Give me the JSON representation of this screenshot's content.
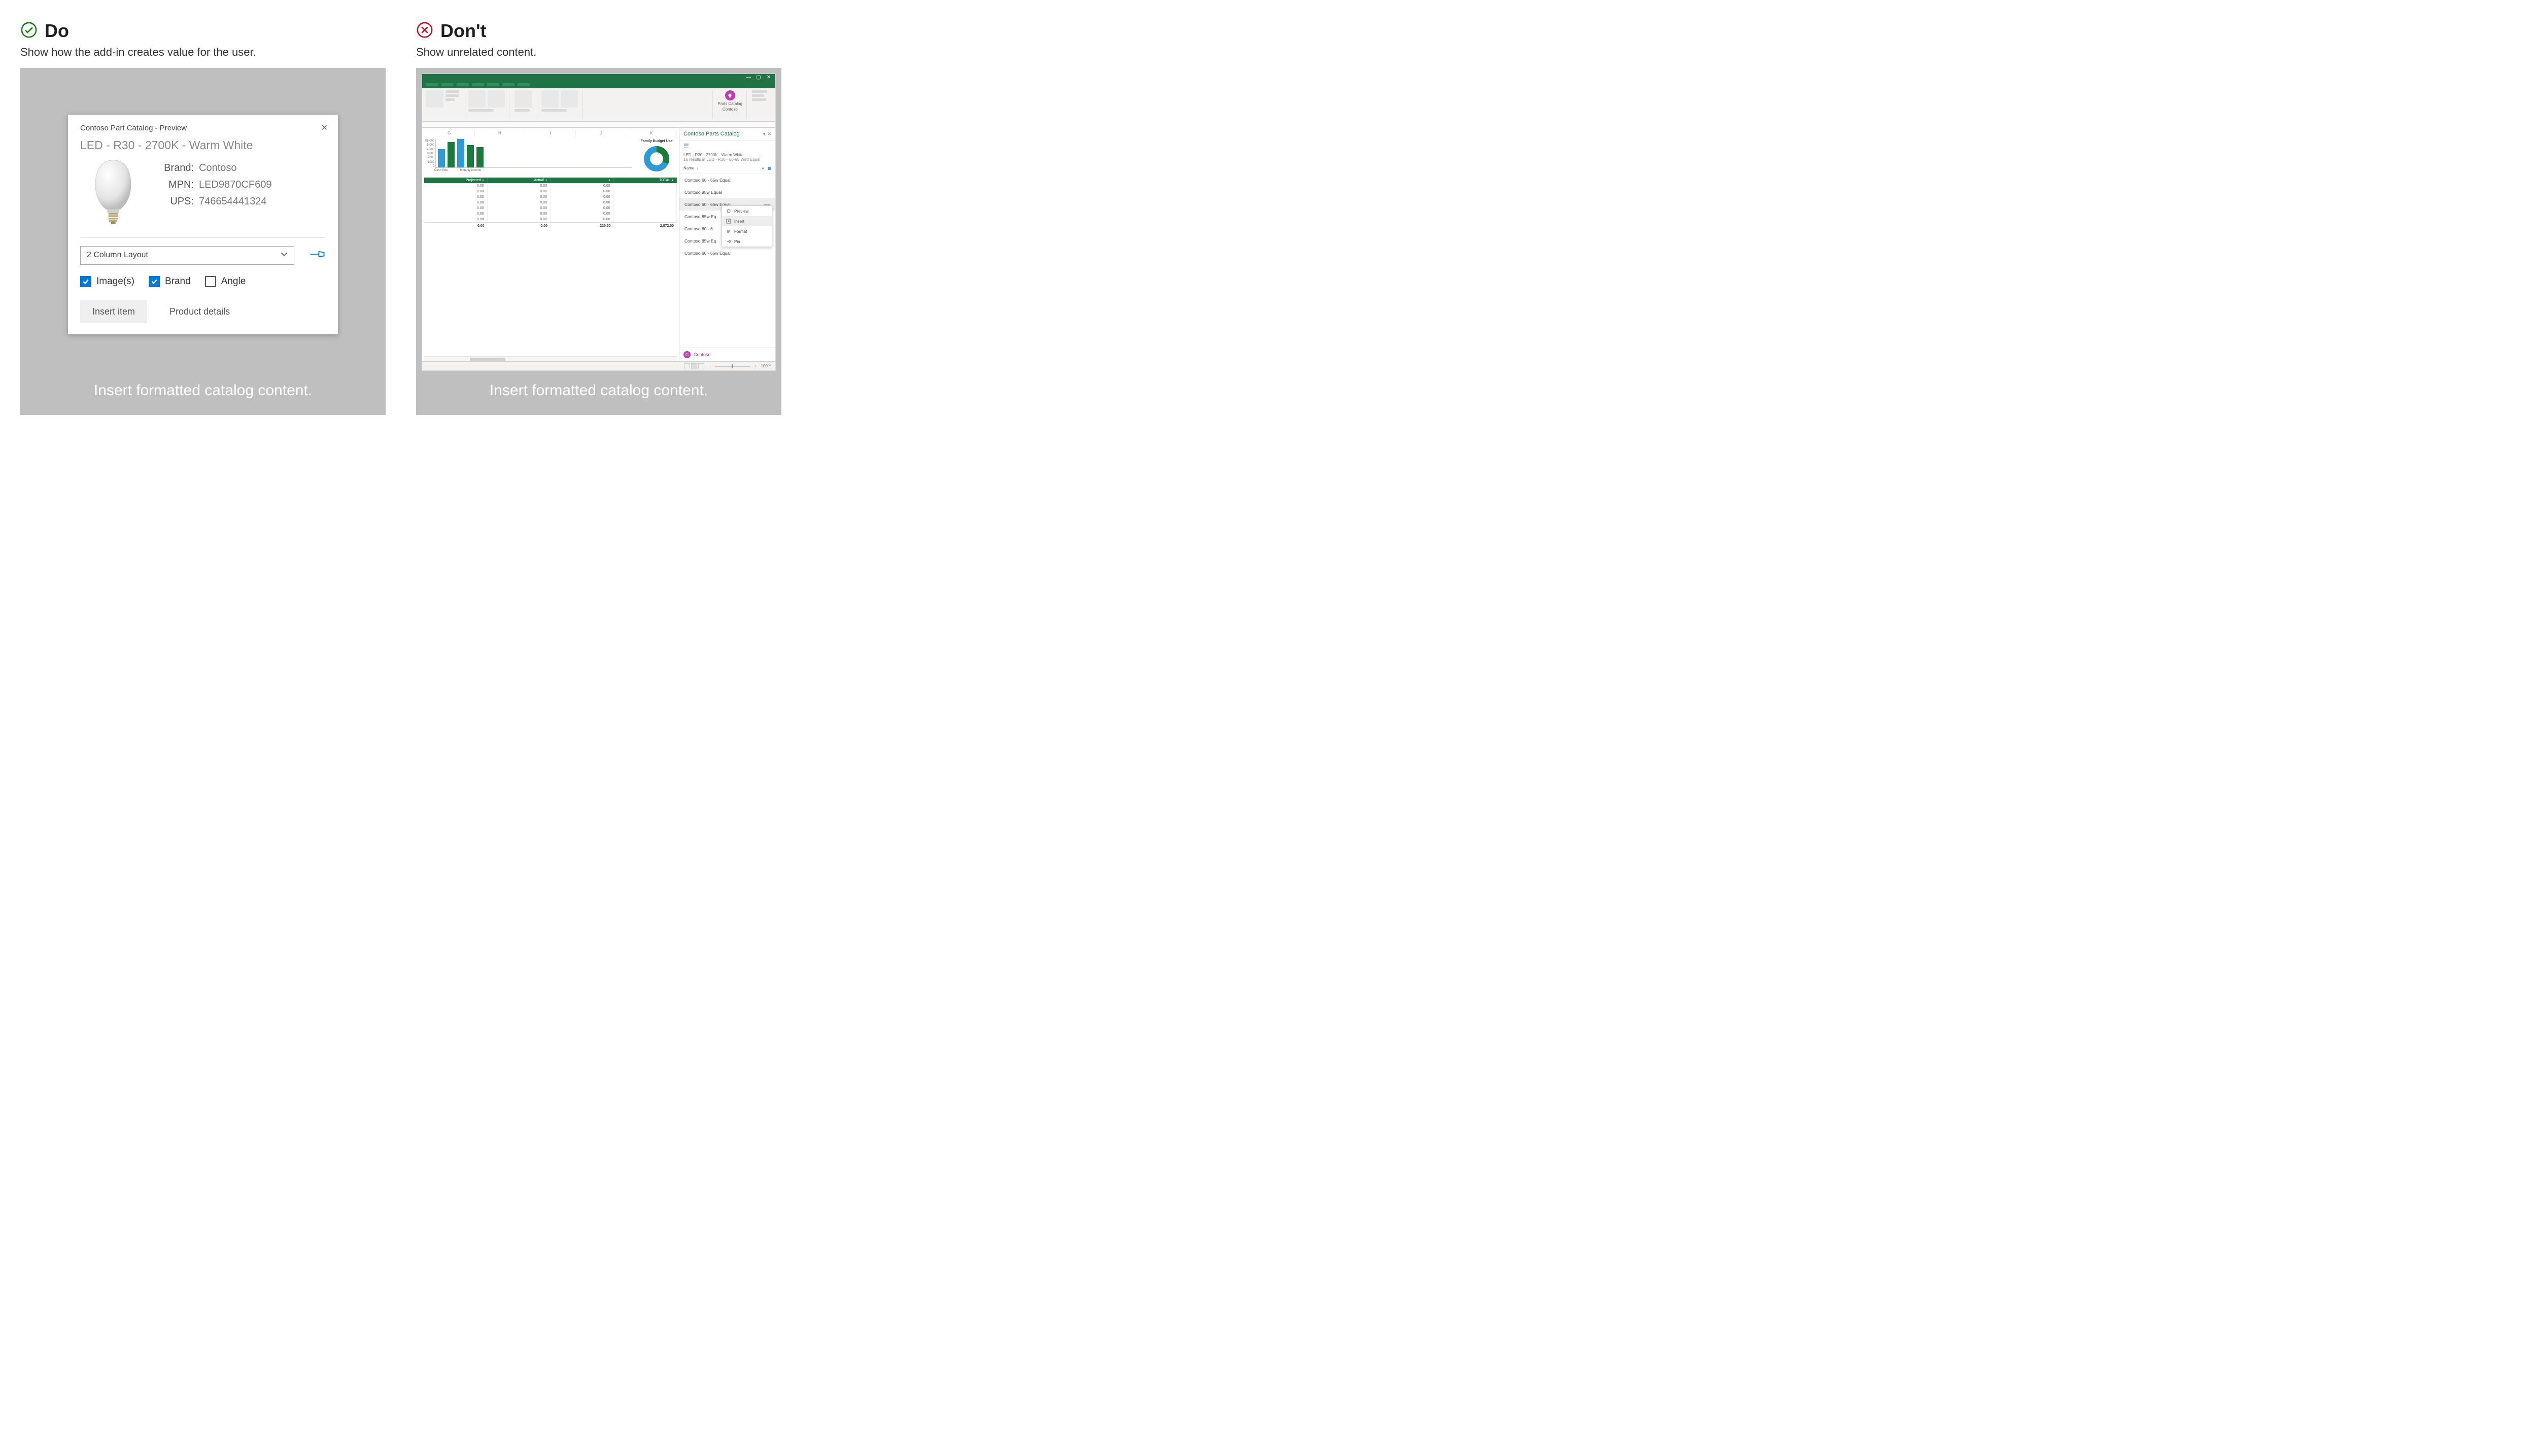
{
  "do": {
    "title": "Do",
    "subtitle": "Show how the add-in creates value for the user.",
    "caption": "Insert formatted catalog content.",
    "dialog": {
      "title": "Contoso Part Catalog - Preview",
      "product_name": "LED - R30 - 2700K - Warm White",
      "brand_k": "Brand:",
      "brand_v": "Contoso",
      "mpn_k": "MPN:",
      "mpn_v": "LED9870CF609",
      "ups_k": "UPS:",
      "ups_v": "746654441324",
      "layout_select": "2 Column Layout",
      "chk_images": "Image(s)",
      "chk_brand": "Brand",
      "chk_angle": "Angle",
      "btn_insert": "Insert item",
      "btn_details": "Product details"
    }
  },
  "dont": {
    "title": "Don't",
    "subtitle": "Show unrelated content.",
    "caption": "Insert formatted catalog content.",
    "excel": {
      "addin_label1": "Parts Catalog",
      "addin_label2": "Contoso",
      "columns": [
        "G",
        "H",
        "I",
        "J",
        "K"
      ],
      "yaxis": [
        "$6,000",
        "5,000",
        "4,000",
        "3,000",
        "2000",
        "1000",
        "0"
      ],
      "bar_series": [
        {
          "h": 36,
          "cls": "b1"
        },
        {
          "h": 50,
          "cls": "b2"
        },
        {
          "h": 56,
          "cls": "b1"
        },
        {
          "h": 44,
          "cls": "b2"
        },
        {
          "h": 40,
          "cls": "b2"
        }
      ],
      "xlabels": [
        "Cash flow",
        "Monthly income"
      ],
      "donut_title": "Family Budget Use",
      "table_headers": [
        "Projected",
        "Actual",
        "",
        "TOTAL"
      ],
      "table_rows": [
        [
          "0.00",
          "0.00",
          "0.00",
          ""
        ],
        [
          "0.00",
          "0.00",
          "0.00",
          ""
        ],
        [
          "0.00",
          "0.00",
          "0.00",
          ""
        ],
        [
          "0.00",
          "0.00",
          "0.00",
          ""
        ],
        [
          "0.00",
          "0.00",
          "0.00",
          ""
        ],
        [
          "0.00",
          "0.00",
          "0.00",
          ""
        ],
        [
          "0.00",
          "0.00",
          "0.00",
          ""
        ]
      ],
      "table_footer": [
        "0.00",
        "0.00",
        "225.50",
        "2,872.00"
      ],
      "taskpane": {
        "title": "Contoso Parts Catalog",
        "breadcrumb": "LED - R30 - 2700K - Warm White",
        "bc_sub": "16 results in LED - R30 - 60-65 Watt Equal",
        "sort_label": "Name",
        "items": [
          "Contoso 60 - 65w Equal",
          "Contoso 85w Equal",
          "Contoso 60 - 65w Equal",
          "Contoso 85w Eq",
          "Contoso 60 - 6",
          "Contoso 85w Eq",
          "Contoso 60 - 65w Equal"
        ],
        "menu": [
          "Preview",
          "Insert",
          "Format",
          "Pin"
        ],
        "footer_initial": "C",
        "footer_name": "Contoso"
      },
      "zoom": "100%"
    }
  }
}
